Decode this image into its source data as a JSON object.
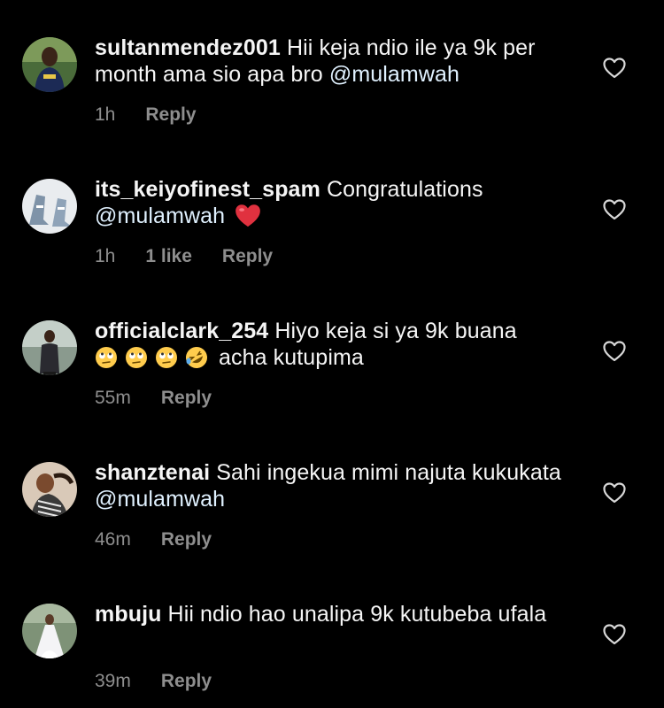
{
  "colors": {
    "background": "#000000",
    "text": "#f5f5f5",
    "meta": "#8e8e8e",
    "heart_emoji": "#e0313f"
  },
  "comments": [
    {
      "username": "sultanmendez001",
      "text_1": "Hii keja ndio ile ya 9k per month ama sio apa bro",
      "mention": "@mulamwah",
      "time": "1h",
      "reply": "Reply",
      "avatar": "person-photo"
    },
    {
      "username": "its_keiyofinest_spam",
      "text_1": "Congratulations",
      "mention": "@mulamwah",
      "emoji": "red-heart-emoji",
      "time": "1h",
      "likes": "1 like",
      "reply": "Reply",
      "avatar": "sneakers-photo"
    },
    {
      "username": "officialclark_254",
      "text_1": "Hiyo keja si ya 9k  buana",
      "text_2": "acha kutupima",
      "emojis": [
        "face-with-rolling-eyes-emoji",
        "face-with-rolling-eyes-emoji",
        "face-with-rolling-eyes-emoji",
        "rolling-on-floor-laughing-emoji"
      ],
      "time": "55m",
      "reply": "Reply",
      "avatar": "person-photo"
    },
    {
      "username": "shanztenai",
      "text_1": "Sahi ingekua mimi najuta kukukata",
      "mention": "@mulamwah",
      "time": "46m",
      "reply": "Reply",
      "avatar": "person-photo"
    },
    {
      "username": "mbuju",
      "text_1": "Hii ndio hao unalipa 9k kutubeba ufala",
      "time": "39m",
      "reply": "Reply",
      "avatar": "bride-photo"
    }
  ]
}
